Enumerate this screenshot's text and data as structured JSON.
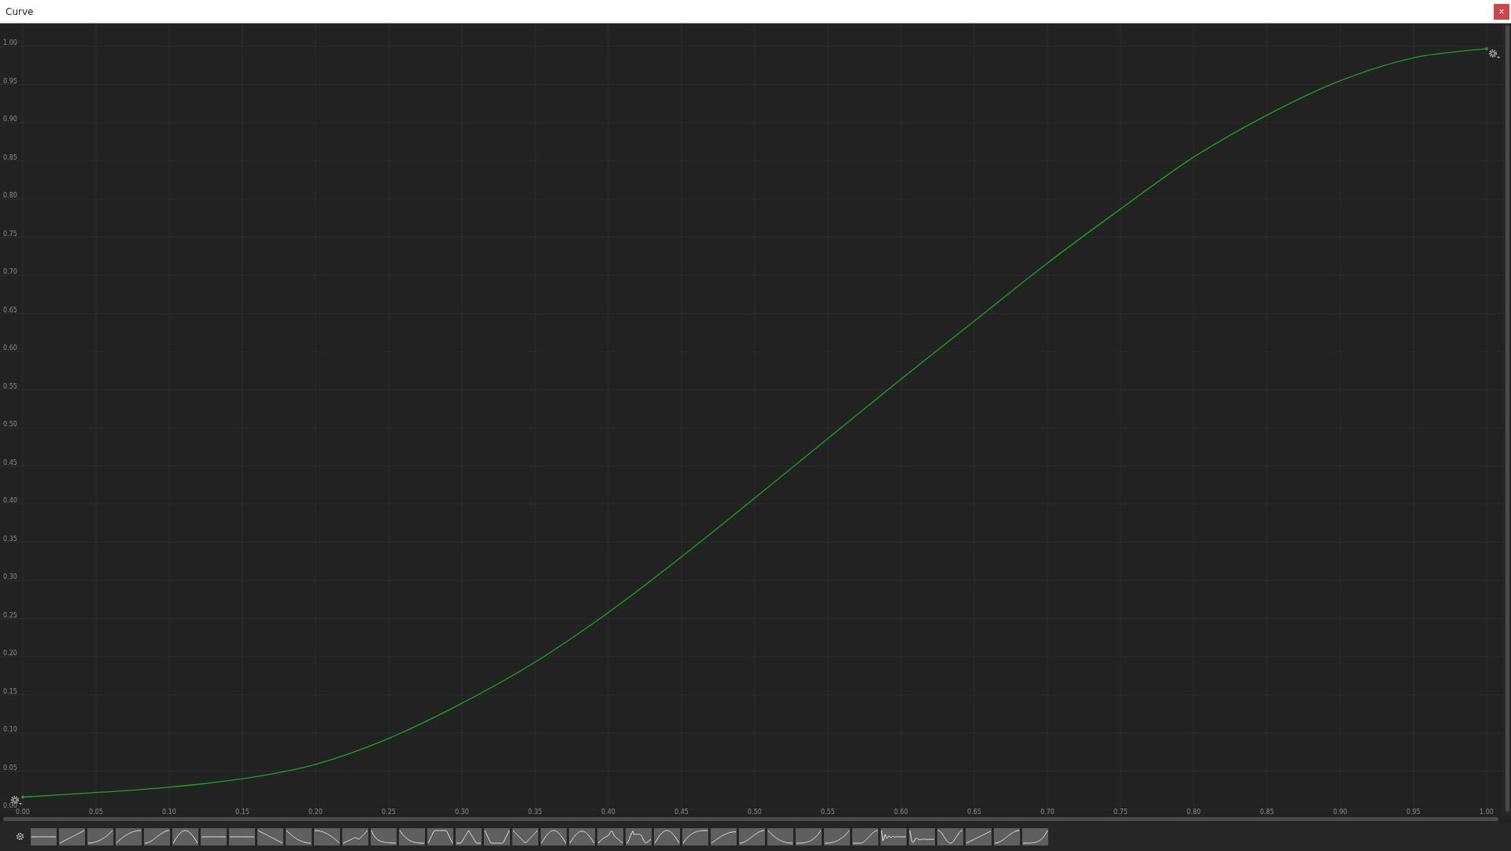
{
  "window": {
    "title": "Curve",
    "close": "×"
  },
  "editor": {
    "chart_data": {
      "type": "line",
      "x": [
        0,
        0.05,
        0.1,
        0.15,
        0.2,
        0.25,
        0.3,
        0.35,
        0.4,
        0.45,
        0.5,
        0.55,
        0.6,
        0.65,
        0.7,
        0.75,
        0.8,
        0.85,
        0.9,
        0.95,
        1
      ],
      "series": [
        {
          "color": "#1fa31f",
          "values": [
            0.016,
            0.022,
            0.029,
            0.04,
            0.059,
            0.093,
            0.139,
            0.193,
            0.258,
            0.331,
            0.408,
            0.486,
            0.564,
            0.64,
            0.716,
            0.787,
            0.855,
            0.91,
            0.955,
            0.985,
            0.997
          ]
        }
      ],
      "xlim": [
        0,
        1
      ],
      "ylim": [
        0,
        1
      ],
      "grid": true,
      "xticks": [
        {
          "value": 0,
          "label": "0.00"
        },
        {
          "value": 0.05,
          "label": "0.05"
        },
        {
          "value": 0.1,
          "label": "0.10"
        },
        {
          "value": 0.15,
          "label": "0.15"
        },
        {
          "value": 0.2,
          "label": "0.20"
        },
        {
          "value": 0.25,
          "label": "0.25"
        },
        {
          "value": 0.3,
          "label": "0.30"
        },
        {
          "value": 0.35,
          "label": "0.35"
        },
        {
          "value": 0.4,
          "label": "0.40"
        },
        {
          "value": 0.45,
          "label": "0.45"
        },
        {
          "value": 0.5,
          "label": "0.50"
        },
        {
          "value": 0.55,
          "label": "0.55"
        },
        {
          "value": 0.6,
          "label": "0.60"
        },
        {
          "value": 0.65,
          "label": "0.65"
        },
        {
          "value": 0.7,
          "label": "0.70"
        },
        {
          "value": 0.75,
          "label": "0.75"
        },
        {
          "value": 0.8,
          "label": "0.80"
        },
        {
          "value": 0.85,
          "label": "0.85"
        },
        {
          "value": 0.9,
          "label": "0.90"
        },
        {
          "value": 0.95,
          "label": "0.95"
        },
        {
          "value": 1,
          "label": "1.00"
        }
      ],
      "yticks": [
        {
          "value": 0,
          "label": "0.00"
        },
        {
          "value": 0.05,
          "label": "0.05"
        },
        {
          "value": 0.1,
          "label": "0.10"
        },
        {
          "value": 0.15,
          "label": "0.15"
        },
        {
          "value": 0.2,
          "label": "0.20"
        },
        {
          "value": 0.25,
          "label": "0.25"
        },
        {
          "value": 0.3,
          "label": "0.30"
        },
        {
          "value": 0.35,
          "label": "0.35"
        },
        {
          "value": 0.4,
          "label": "0.40"
        },
        {
          "value": 0.45,
          "label": "0.45"
        },
        {
          "value": 0.5,
          "label": "0.50"
        },
        {
          "value": 0.55,
          "label": "0.55"
        },
        {
          "value": 0.6,
          "label": "0.60"
        },
        {
          "value": 0.65,
          "label": "0.65"
        },
        {
          "value": 0.7,
          "label": "0.70"
        },
        {
          "value": 0.75,
          "label": "0.75"
        },
        {
          "value": 0.8,
          "label": "0.80"
        },
        {
          "value": 0.85,
          "label": "0.85"
        },
        {
          "value": 0.9,
          "label": "0.90"
        },
        {
          "value": 0.95,
          "label": "0.95"
        },
        {
          "value": 1,
          "label": "1.00"
        }
      ]
    }
  }
}
